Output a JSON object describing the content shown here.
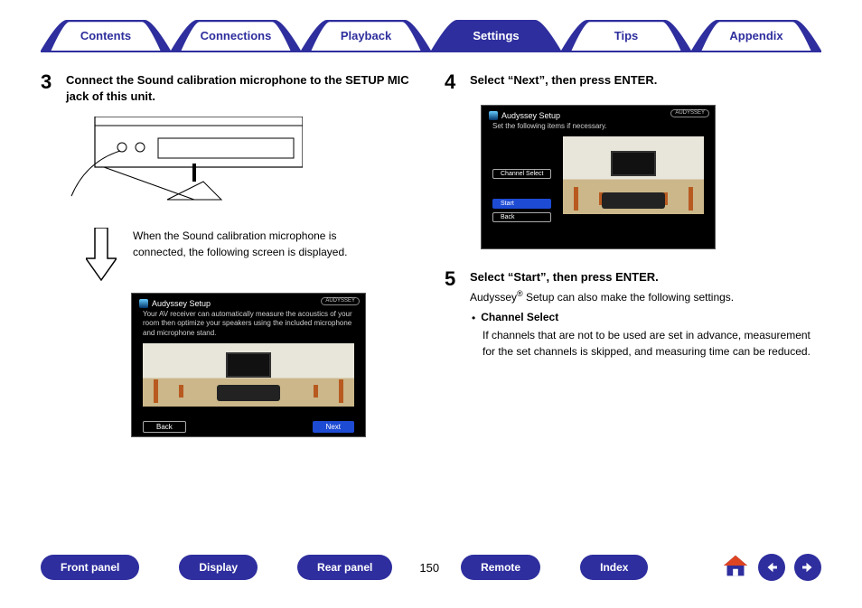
{
  "tabs": {
    "contents": "Contents",
    "connections": "Connections",
    "playback": "Playback",
    "settings": "Settings",
    "tips": "Tips",
    "appendix": "Appendix"
  },
  "step3": {
    "num": "3",
    "title": "Connect the Sound calibration microphone to the SETUP MIC jack of this unit.",
    "note": "When the Sound calibration microphone is connected, the following screen is displayed."
  },
  "osd1": {
    "title": "Audyssey Setup",
    "badge": "AUDYSSEY",
    "body": "Your AV receiver can automatically measure the acoustics of your room then optimize your speakers using the included microphone and microphone stand.",
    "back": "Back",
    "next": "Next"
  },
  "step4": {
    "num": "4",
    "title": "Select “Next”, then press ENTER."
  },
  "osd2": {
    "title": "Audyssey Setup",
    "badge": "AUDYSSEY",
    "body": "Set the following items if necessary.",
    "channel": "Channel Select",
    "start": "Start",
    "back": "Back"
  },
  "step5": {
    "num": "5",
    "title": "Select “Start”, then press ENTER.",
    "desc_pre": "Audyssey",
    "desc_post": " Setup can also make the following settings.",
    "bullet_title": "Channel Select",
    "bullet_body": "If channels that are not to be used are set in advance, measurement for the set channels is skipped, and measuring time can be reduced."
  },
  "bottom": {
    "front": "Front panel",
    "display": "Display",
    "rear": "Rear panel",
    "page": "150",
    "remote": "Remote",
    "index": "Index"
  }
}
